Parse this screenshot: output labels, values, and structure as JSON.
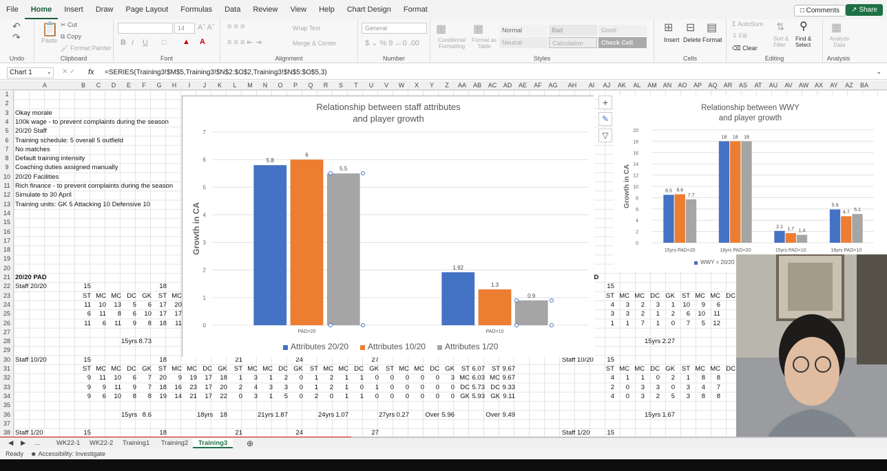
{
  "menu": {
    "tabs": [
      "File",
      "Home",
      "Insert",
      "Draw",
      "Page Layout",
      "Formulas",
      "Data",
      "Review",
      "View",
      "Help",
      "Chart Design",
      "Format"
    ],
    "comments": "Comments",
    "share": "Share"
  },
  "ribbon": {
    "undo_label": "Undo",
    "clipboard": {
      "paste": "Paste",
      "cut": "Cut",
      "copy": "Copy",
      "format_painter": "Format Painter",
      "label": "Clipboard"
    },
    "font": {
      "size": "14",
      "label": "Font"
    },
    "alignment": {
      "wrap": "Wrap Text",
      "merge": "Merge & Center",
      "label": "Alignment"
    },
    "number": {
      "format": "General",
      "label": "Number"
    },
    "styles": {
      "conditional": "Conditional Formatting",
      "format_table": "Format as Table",
      "normal": "Normal",
      "bad": "Bad",
      "good": "Good",
      "neutral": "Neutral",
      "calculation": "Calculation",
      "check": "Check Cell",
      "label": "Styles"
    },
    "cells": {
      "insert": "Insert",
      "delete": "Delete",
      "format": "Format",
      "label": "Cells"
    },
    "editing": {
      "autosum": "AutoSum",
      "fill": "Fill",
      "clear": "Clear",
      "sort": "Sort & Filter",
      "find": "Find & Select",
      "label": "Editing"
    },
    "analysis": {
      "analyze": "Analyze Data",
      "label": "Analysis"
    }
  },
  "formula_bar": {
    "name_box": "Chart 1",
    "fx": "fx",
    "formula": "=SERIES(Training3!$M$5,Training3!$N$2:$O$2,Training3!$N$5:$O$5,3)"
  },
  "columns": [
    "A",
    "B",
    "C",
    "D",
    "E",
    "F",
    "G",
    "H",
    "I",
    "J",
    "K",
    "L",
    "M",
    "N",
    "O",
    "P",
    "Q",
    "R",
    "S",
    "T",
    "U",
    "V",
    "W",
    "X",
    "Y",
    "Z",
    "AA",
    "AB",
    "AC",
    "AD",
    "AE",
    "AF",
    "AG",
    "AH",
    "AI",
    "AJ",
    "AK",
    "AL",
    "AM",
    "AN",
    "AO",
    "AP",
    "AQ",
    "AR",
    "AS",
    "AT",
    "AU",
    "AV",
    "AW",
    "AX",
    "AY",
    "AZ",
    "BA"
  ],
  "rows": [
    "1",
    "2",
    "3",
    "4",
    "5",
    "6",
    "7",
    "8",
    "9",
    "10",
    "11",
    "12",
    "13",
    "14",
    "15",
    "16",
    "17",
    "18",
    "19",
    "20",
    "21",
    "22",
    "23",
    "24",
    "25",
    "26",
    "27",
    "28",
    "29",
    "30",
    "31",
    "32",
    "33",
    "34",
    "35",
    "36",
    "37",
    "38"
  ],
  "notes": [
    "Okay morale",
    "100k wage - to prevent complaints during the season",
    "20/20 Staff",
    "Training schedule: 5 overall 5 outfield",
    "No matches",
    "Default training intensity",
    "Coaching duties assigned manually",
    "20/20 Facilities",
    "Rich finance - to prevent complaints during the season",
    "Simulate to 30 April",
    "Training units: GK 5 Attacking 10 Defensive 10"
  ],
  "sheet_cells": {
    "r21a": "20/20 PAD",
    "r22a": "Staff 20/20",
    "r22b": "15",
    "r22g": "18",
    "r23": [
      "ST",
      "MC",
      "MC",
      "DC",
      "GK",
      "ST",
      "MC"
    ],
    "r24": [
      "11",
      "10",
      "13",
      "5",
      "6",
      "17",
      "20"
    ],
    "r25": [
      "6",
      "11",
      "8",
      "6",
      "10",
      "17",
      "17"
    ],
    "r26": [
      "11",
      "6",
      "11",
      "9",
      "8",
      "18",
      "11"
    ],
    "r28": [
      "15yrs",
      "8.73"
    ],
    "r30a": "Staff 10/20",
    "r30b": "15",
    "r30g": "18",
    "r30l": "21",
    "r30p": "24",
    "r30u": "27",
    "r31": [
      "ST",
      "MC",
      "MC",
      "DC",
      "GK",
      "ST",
      "MC",
      "MC",
      "DC",
      "GK",
      "ST",
      "MC",
      "MC",
      "DC",
      "GK",
      "ST",
      "MC",
      "MC",
      "DC",
      "GK",
      "ST",
      "MC",
      "MC",
      "DC",
      "GK",
      "ST",
      "6.07",
      "ST",
      "9.67"
    ],
    "r32": [
      "9",
      "11",
      "10",
      "6",
      "7",
      "20",
      "9",
      "19",
      "17",
      "18",
      "1",
      "3",
      "1",
      "2",
      "0",
      "1",
      "2",
      "1",
      "1",
      "0",
      "0",
      "0",
      "0",
      "0",
      "3",
      "MC",
      "6.03",
      "MC",
      "9.67"
    ],
    "r33": [
      "9",
      "9",
      "11",
      "9",
      "7",
      "18",
      "16",
      "23",
      "17",
      "20",
      "2",
      "4",
      "3",
      "3",
      "0",
      "1",
      "2",
      "1",
      "0",
      "1",
      "0",
      "0",
      "0",
      "0",
      "0",
      "DC",
      "5.73",
      "DC",
      "9.33"
    ],
    "r34": [
      "9",
      "6",
      "10",
      "8",
      "8",
      "19",
      "14",
      "21",
      "17",
      "22",
      "0",
      "3",
      "1",
      "5",
      "0",
      "2",
      "0",
      "1",
      "1",
      "0",
      "0",
      "0",
      "0",
      "0",
      "0",
      "GK",
      "5.93",
      "GK",
      "9.11"
    ],
    "r36": [
      "15yrs",
      "8.6",
      "18yrs",
      "18",
      "21yrs",
      "1.87",
      "24yrs",
      "1.07",
      "27yrs",
      "0.27",
      "Over",
      "5.96",
      "Over",
      "9.49"
    ],
    "r38a": "Staff 1/20",
    "r38b": "15",
    "r38g": "18",
    "r38l": "21",
    "r38p": "24",
    "r38u": "27",
    "right_r21": "PAD",
    "right_r22": "Staff 20/20",
    "right_r22b": "15",
    "right_r23": [
      "ST",
      "MC",
      "MC",
      "DC",
      "GK",
      "ST",
      "MC",
      "MC",
      "DC"
    ],
    "right_r24": [
      "4",
      "3",
      "2",
      "3",
      "1",
      "10",
      "9",
      "6"
    ],
    "right_r25": [
      "3",
      "3",
      "2",
      "1",
      "2",
      "6",
      "10",
      "11"
    ],
    "right_r26": [
      "1",
      "1",
      "7",
      "1",
      "0",
      "7",
      "5",
      "12"
    ],
    "right_r28": [
      "15yrs",
      "2.27"
    ],
    "right_r30": "Staff 10/20",
    "right_r30b": "15",
    "right_r31": [
      "ST",
      "MC",
      "MC",
      "DC",
      "GK",
      "ST",
      "MC",
      "MC",
      "DC"
    ],
    "right_r32": [
      "4",
      "1",
      "1",
      "0",
      "2",
      "1",
      "8",
      "8"
    ],
    "right_r33": [
      "2",
      "0",
      "3",
      "3",
      "0",
      "3",
      "4",
      "7"
    ],
    "right_r34": [
      "4",
      "0",
      "3",
      "2",
      "5",
      "3",
      "8",
      "8"
    ],
    "right_r36": [
      "15yrs",
      "1.67"
    ],
    "right_r38": "Staff 1/20",
    "right_r38b": "15"
  },
  "sheet_tabs": [
    "WK22-1",
    "WK22-2",
    "Training1",
    "Training2",
    "Training3"
  ],
  "sheet_nav": "...",
  "status": {
    "ready": "Ready",
    "accessibility": "Accessibility: Investigate"
  },
  "colors": {
    "blue": "#4472c4",
    "orange": "#ed7d31",
    "gray": "#a5a5a5",
    "excel_green": "#1e7145"
  },
  "chart_data": [
    {
      "type": "bar",
      "title": "Relationship between staff attributes and player growth",
      "title_lines": [
        "Relationship between staff attributes",
        "and player growth"
      ],
      "ylabel": "Growth in CA",
      "ylim": [
        0,
        7
      ],
      "yticks": [
        "0",
        "1",
        "2",
        "3",
        "4",
        "5",
        "6",
        "7"
      ],
      "categories": [
        "PAD=20",
        "PAD=10"
      ],
      "series": [
        {
          "name": "Attributes 20/20",
          "values": [
            5.8,
            1.92
          ],
          "labels": [
            "5.8",
            "1.92"
          ]
        },
        {
          "name": "Attributes 10/20",
          "values": [
            6,
            1.3
          ],
          "labels": [
            "6",
            "1.3"
          ]
        },
        {
          "name": "Attributes 1/20",
          "values": [
            5.5,
            0.9
          ],
          "labels": [
            "5.5",
            "0.9"
          ]
        }
      ],
      "legend": "bottom",
      "grid": true
    },
    {
      "type": "bar",
      "title": "Relationship between WWY and player growth",
      "title_lines": [
        "Relationship between WWY",
        "and player growth"
      ],
      "ylabel": "Growth in CA",
      "ylim": [
        0,
        20
      ],
      "yticks": [
        "0",
        "2",
        "4",
        "6",
        "8",
        "10",
        "12",
        "14",
        "16",
        "18",
        "20"
      ],
      "categories": [
        "15yrs PAD=20",
        "18yrs PAD=20",
        "15yrs PAD=10",
        "18yrs PAD=10"
      ],
      "series": [
        {
          "name": "WWY = 20/20",
          "values": [
            8.5,
            18,
            2.1,
            5.9
          ],
          "labels": [
            "8.5",
            "18",
            "2.1",
            "5.9"
          ]
        },
        {
          "name": "",
          "values": [
            8.6,
            18,
            1.7,
            4.7
          ],
          "labels": [
            "8.6",
            "18",
            "1.7",
            "4.7"
          ]
        },
        {
          "name": "",
          "values": [
            7.7,
            18,
            1.4,
            5.1
          ],
          "labels": [
            "7.7",
            "18",
            "1.4",
            "5.1"
          ]
        }
      ],
      "legend": "bottom",
      "grid": true
    }
  ]
}
